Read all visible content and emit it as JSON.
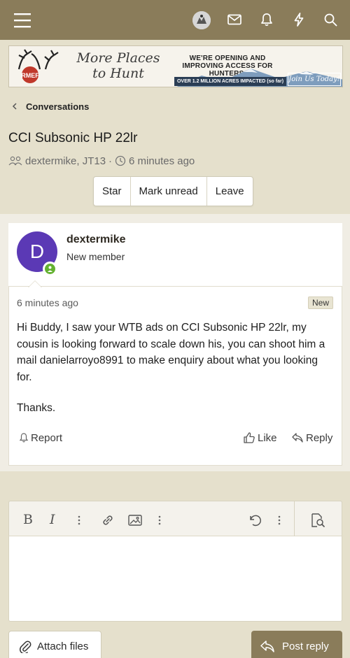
{
  "colors": {
    "header_bg": "#8a7c5a",
    "page_bg": "#e5e0cc",
    "avatar_bg": "#5b39b5",
    "online": "#63b130",
    "accent_button": "#8a7c5a"
  },
  "topbar": {
    "icons": [
      "menu-icon",
      "user-avatar",
      "envelope-icon",
      "bell-icon",
      "bolt-icon",
      "search-icon"
    ]
  },
  "banner": {
    "logo_text": "RMEF",
    "script_text": "More Places to Hunt",
    "headline": "WE'RE OPENING AND IMPROVING ACCESS FOR HUNTERS.",
    "acres": "OVER 1.2 MILLION ACRES IMPACTED (so far)",
    "cta": "Join Us Today!"
  },
  "breadcrumb": {
    "label": "Conversations"
  },
  "conversation": {
    "title": "CCI Subsonic HP 22lr",
    "participants": "dextermike, JT13",
    "separator": "·",
    "time": "6 minutes ago"
  },
  "buttons": {
    "star": "Star",
    "mark_unread": "Mark unread",
    "leave": "Leave"
  },
  "message": {
    "avatar_letter": "D",
    "author": "dextermike",
    "role": "New member",
    "time": "6 minutes ago",
    "badge": "New",
    "body": "Hi Buddy, I saw your WTB ads on CCI Subsonic HP 22lr, my cousin is looking forward to scale down his, you can shoot him a mail danielarroyo8991 to make enquiry about what you looking for.",
    "closing": "Thanks.",
    "report": "Report",
    "like": "Like",
    "reply": "Reply"
  },
  "editor": {
    "tools": [
      "bold-icon",
      "italic-icon",
      "more-options-icon",
      "link-icon",
      "image-icon",
      "more-options-icon",
      "undo-icon",
      "more-options-icon",
      "preview-icon"
    ],
    "bold": "B",
    "italic": "I"
  },
  "footer": {
    "attach": "Attach files",
    "post": "Post reply"
  }
}
